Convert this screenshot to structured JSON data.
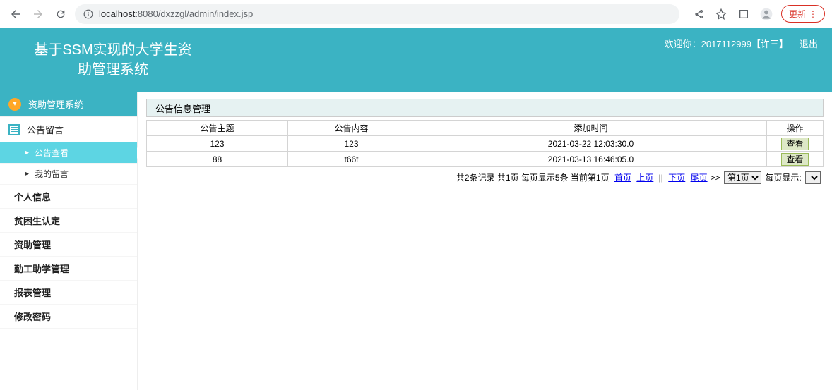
{
  "browser": {
    "url_prefix": "localhost",
    "url_rest": ":8080/dxzzgl/admin/index.jsp",
    "update_label": "更新"
  },
  "header": {
    "title_line1": "基于SSM实现的大学生资",
    "title_line2": "助管理系统",
    "welcome": "欢迎你：2017112999【许三】",
    "logout": "退出"
  },
  "sidebar": {
    "system_label": "资助管理系统",
    "msg_group": "公告留言",
    "sub_view": "公告查看",
    "sub_mine": "我的留言",
    "items": [
      "个人信息",
      "贫困生认定",
      "资助管理",
      "勤工助学管理",
      "报表管理",
      "修改密码"
    ]
  },
  "content": {
    "panel_title": "公告信息管理",
    "cols": {
      "topic": "公告主题",
      "content": "公告内容",
      "time": "添加时间",
      "action": "操作"
    },
    "rows": [
      {
        "topic": "123",
        "content": "123",
        "time": "2021-03-22 12:03:30.0",
        "action": "查看"
      },
      {
        "topic": "88",
        "content": "t66t",
        "time": "2021-03-13 16:46:05.0",
        "action": "查看"
      }
    ],
    "pager": {
      "summary": "共2条记录 共1页 每页显示5条 当前第1页",
      "first": "首页",
      "prev": "上页",
      "sep": "||",
      "next": "下页",
      "last": "尾页",
      "tail": ">>",
      "page_select": "第1页",
      "per_label": "每页显示:"
    }
  }
}
